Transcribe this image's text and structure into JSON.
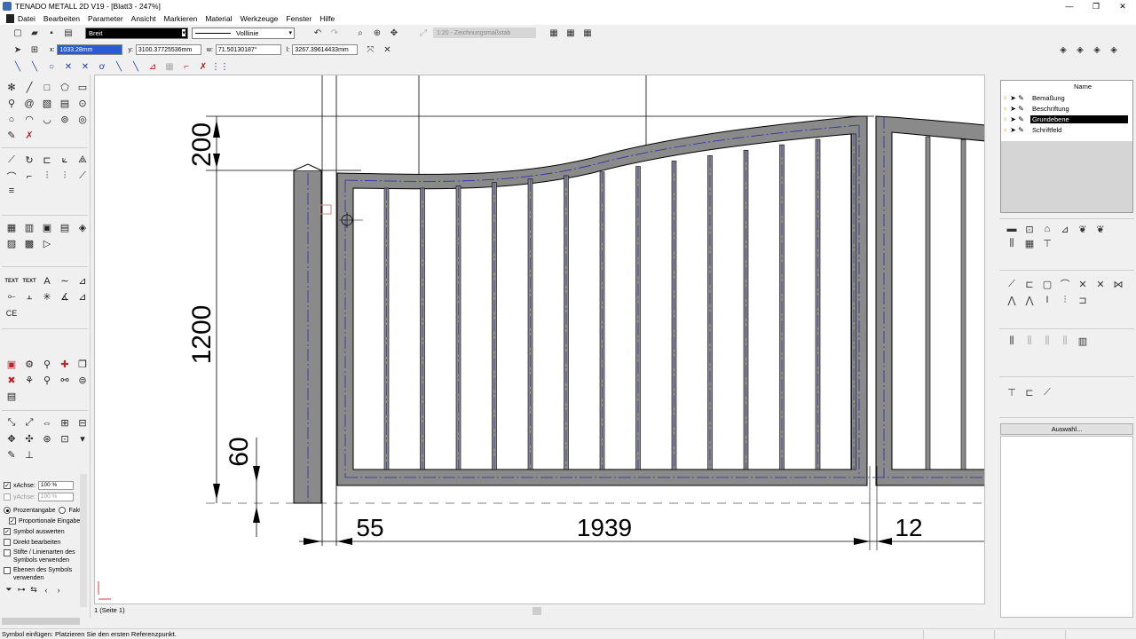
{
  "window": {
    "title": "TENADO METALL 2D V19 - [Blatt3 - 247%]"
  },
  "menu": [
    "Datei",
    "Bearbeiten",
    "Parameter",
    "Ansicht",
    "Markieren",
    "Material",
    "Werkzeuge",
    "Fenster",
    "Hilfe"
  ],
  "toolbar": {
    "pen_width": "Breit",
    "line_type": "Volllinie",
    "scale_placeholder": "1:20 - Zeichnungsmaßstab"
  },
  "coords": {
    "x_label": "x:",
    "x_value": "1033.28mm",
    "y_label": "y:",
    "y_value": "3100.37725536mm",
    "w_label": "w:",
    "w_value": "71.50130187°",
    "l_label": "l:",
    "l_value": "3267.39614433mm"
  },
  "left_options": {
    "x_axis_label": "xAchse:",
    "x_axis_value": "100 %",
    "y_axis_label": "yAchse:",
    "y_axis_value": "100 %",
    "radio_percent": "Prozentangabe",
    "radio_factor": "Fakt",
    "proportional": "Proportionale Eingabe",
    "evaluate_symbol": "Symbol auswerten",
    "edit_direct": "Direkt bearbeiten",
    "use_pens": "Stifte / Linienarten des Symbols verwenden",
    "use_layers": "Ebenen des Symbols verwenden"
  },
  "layers": {
    "header": "Name",
    "items": [
      {
        "name": "Bemaßung",
        "active": false
      },
      {
        "name": "Beschriftung",
        "active": false
      },
      {
        "name": "Grundebene",
        "active": true
      },
      {
        "name": "Schriftfeld",
        "active": false
      }
    ]
  },
  "right_panel": {
    "selection_button": "Auswahl..."
  },
  "drawing": {
    "dimensions": [
      "200",
      "1200",
      "60",
      "55",
      "1939",
      "12"
    ]
  },
  "page_tab": "1 (Seite 1)",
  "status": "Symbol einfügen: Platzieren Sie den ersten Referenzpunkt.",
  "colors": {
    "accent": "#2a5bd7",
    "steel": "#8a8a8a",
    "axis_line": "#2a2aa8"
  }
}
